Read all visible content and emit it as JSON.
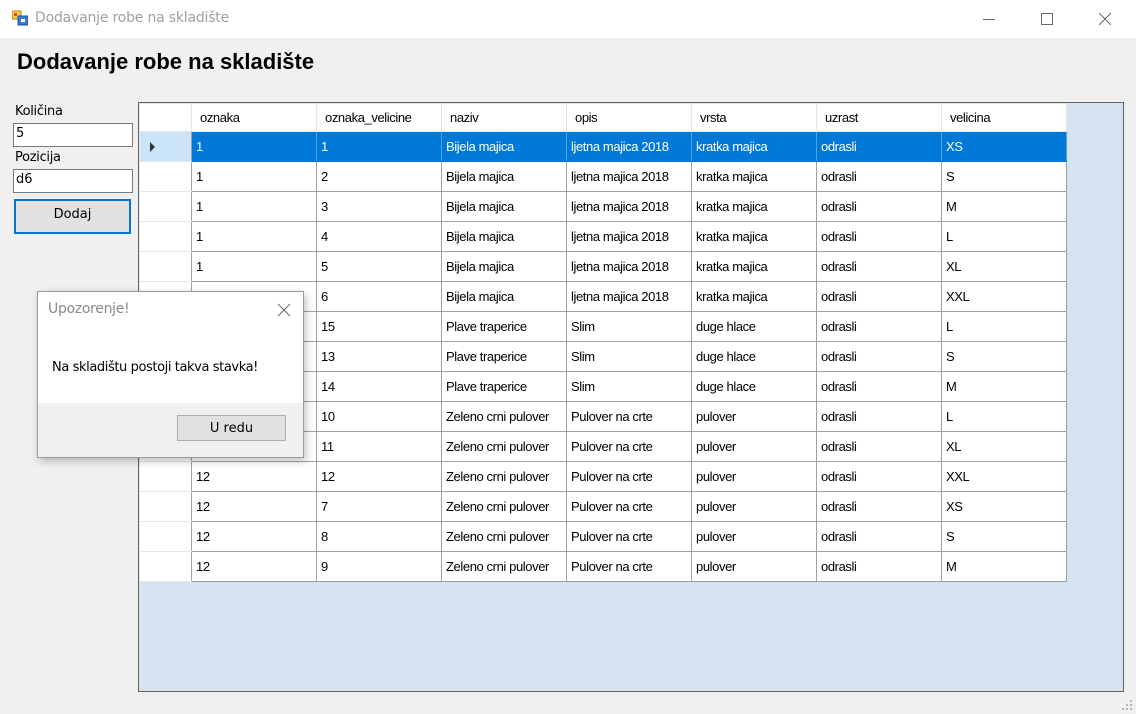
{
  "window": {
    "title": "Dodavanje robe na skladište",
    "icon": "winforms-app-icon",
    "minimize_icon": "minimize-icon",
    "maximize_icon": "maximize-icon",
    "close_icon": "close-icon"
  },
  "heading": "Dodavanje robe na skladište",
  "form": {
    "kolicina_label": "Količina",
    "kolicina_value": "5",
    "pozicija_label": "Pozicija",
    "pozicija_value": "d6",
    "dodaj_label": "Dodaj"
  },
  "grid": {
    "columns": [
      "oznaka",
      "oznaka_velicine",
      "naziv",
      "opis",
      "vrsta",
      "uzrast",
      "velicina"
    ],
    "selected_row": 0,
    "rows": [
      [
        "1",
        "1",
        "Bijela majica",
        "ljetna majica 2018",
        "kratka majica",
        "odrasli",
        "XS"
      ],
      [
        "1",
        "2",
        "Bijela majica",
        "ljetna majica 2018",
        "kratka majica",
        "odrasli",
        "S"
      ],
      [
        "1",
        "3",
        "Bijela majica",
        "ljetna majica 2018",
        "kratka majica",
        "odrasli",
        "M"
      ],
      [
        "1",
        "4",
        "Bijela majica",
        "ljetna majica 2018",
        "kratka majica",
        "odrasli",
        "L"
      ],
      [
        "1",
        "5",
        "Bijela majica",
        "ljetna majica 2018",
        "kratka majica",
        "odrasli",
        "XL"
      ],
      [
        "1",
        "6",
        "Bijela majica",
        "ljetna majica 2018",
        "kratka majica",
        "odrasli",
        "XXL"
      ],
      [
        "",
        "15",
        "Plave traperice",
        "Slim",
        "duge hlace",
        "odrasli",
        "L"
      ],
      [
        "",
        "13",
        "Plave traperice",
        "Slim",
        "duge hlace",
        "odrasli",
        "S"
      ],
      [
        "",
        "14",
        "Plave traperice",
        "Slim",
        "duge hlace",
        "odrasli",
        "M"
      ],
      [
        "",
        "10",
        "Zeleno crni pulover",
        "Pulover na crte",
        "pulover",
        "odrasli",
        "L"
      ],
      [
        "",
        "11",
        "Zeleno crni pulover",
        "Pulover na crte",
        "pulover",
        "odrasli",
        "XL"
      ],
      [
        "12",
        "12",
        "Zeleno crni pulover",
        "Pulover na crte",
        "pulover",
        "odrasli",
        "XXL"
      ],
      [
        "12",
        "7",
        "Zeleno crni pulover",
        "Pulover na crte",
        "pulover",
        "odrasli",
        "XS"
      ],
      [
        "12",
        "8",
        "Zeleno crni pulover",
        "Pulover na crte",
        "pulover",
        "odrasli",
        "S"
      ],
      [
        "12",
        "9",
        "Zeleno crni pulover",
        "Pulover na crte",
        "pulover",
        "odrasli",
        "M"
      ]
    ]
  },
  "dialog": {
    "title": "Upozorenje!",
    "message": "Na skladištu postoji takva stavka!",
    "ok_label": "U redu",
    "close_icon": "close-icon"
  },
  "colors": {
    "selection": "#0078d7",
    "grid_background": "#d6e3f1",
    "focus_border": "#0078d7"
  }
}
